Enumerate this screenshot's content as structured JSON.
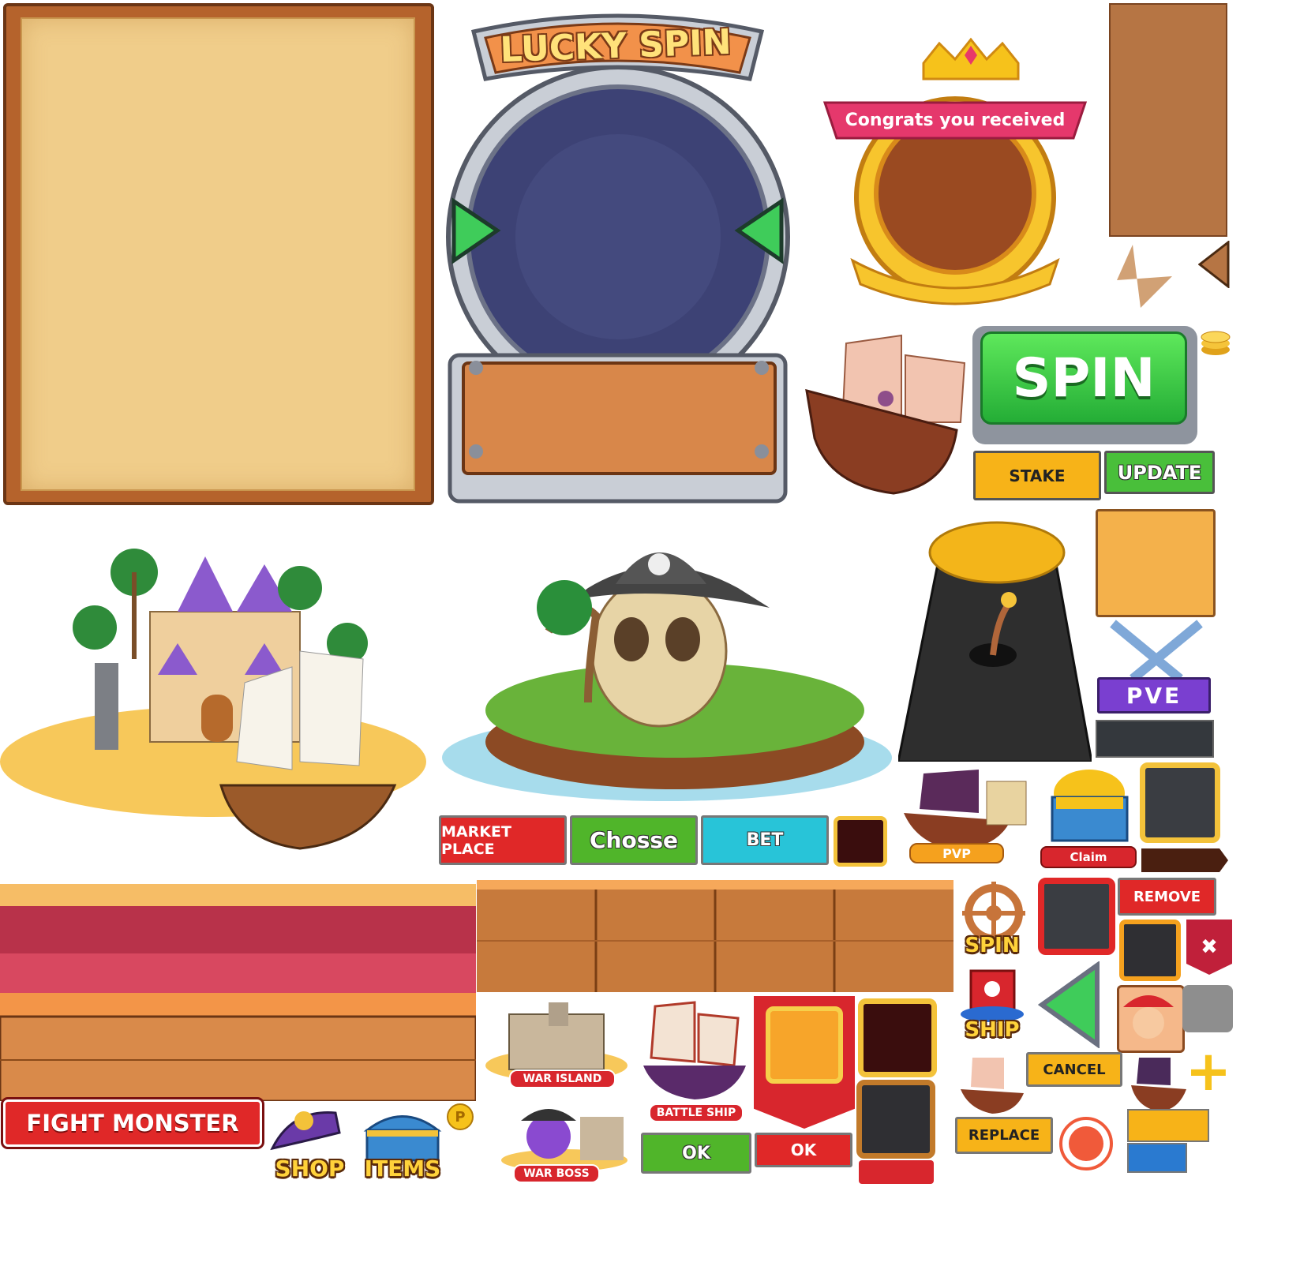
{
  "lucky_spin": {
    "title": "LUCKY SPIN"
  },
  "reward_panel": {
    "ribbon": "Congrats you received"
  },
  "buttons": {
    "spin": "SPIN",
    "stake": "STAKE",
    "update": "UPDATE",
    "market_place": "MARKET PLACE",
    "chosse": "Chosse",
    "bet": "BET",
    "remove": "REMOVE",
    "cancel": "CANCEL",
    "replace": "REPLACE",
    "ok_green": "OK",
    "ok_red": "OK",
    "fight_monster": "FIGHT MONSTER"
  },
  "icons": {
    "pve": "PVE",
    "pvp": "PVP",
    "claim": "Claim",
    "spin": "SPIN",
    "ship": "SHIP",
    "shop": "SHOP",
    "items": "ITEMS",
    "war_island": "WAR ISLAND",
    "battle_ship": "BATTLE SHIP",
    "war_boss": "WAR BOSS",
    "coin_letter": "P"
  },
  "colors": {
    "parchment": "#f3d08a",
    "wood": "#c7743a",
    "green": "#4cc13a",
    "red": "#d8262d",
    "orange": "#f5a11e",
    "cyan": "#21c3d8",
    "purple": "#7a3fd0"
  }
}
